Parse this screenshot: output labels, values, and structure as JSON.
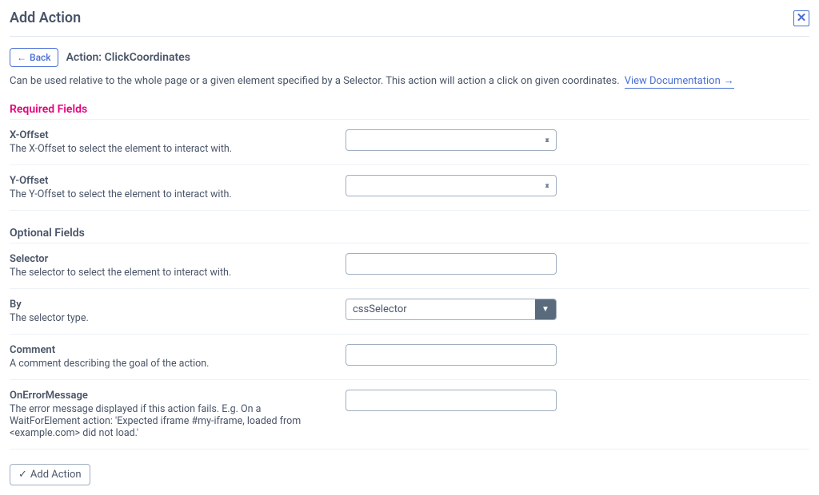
{
  "modal": {
    "title": "Add Action",
    "close_label": "✕"
  },
  "header": {
    "back_label": "Back",
    "action_title": "Action: ClickCoordinates"
  },
  "description": {
    "text": "Can be used relative to the whole page or a given element specified by a Selector. This action will action a click on given coordinates.",
    "doc_link_label": "View Documentation"
  },
  "sections": {
    "required_heading": "Required Fields",
    "optional_heading": "Optional Fields"
  },
  "fields": {
    "x_offset": {
      "label": "X-Offset",
      "desc": "The X-Offset to select the element to interact with.",
      "value": ""
    },
    "y_offset": {
      "label": "Y-Offset",
      "desc": "The Y-Offset to select the element to interact with.",
      "value": ""
    },
    "selector": {
      "label": "Selector",
      "desc": "The selector to select the element to interact with.",
      "value": ""
    },
    "by": {
      "label": "By",
      "desc": "The selector type.",
      "value": "cssSelector"
    },
    "comment": {
      "label": "Comment",
      "desc": "A comment describing the goal of the action.",
      "value": ""
    },
    "on_error": {
      "label": "OnErrorMessage",
      "desc": "The error message displayed if this action fails. E.g. On a WaitForElement action: 'Expected iframe #my-iframe, loaded from <example.com> did not load.'",
      "value": ""
    }
  },
  "footer": {
    "add_action_label": "Add Action"
  }
}
